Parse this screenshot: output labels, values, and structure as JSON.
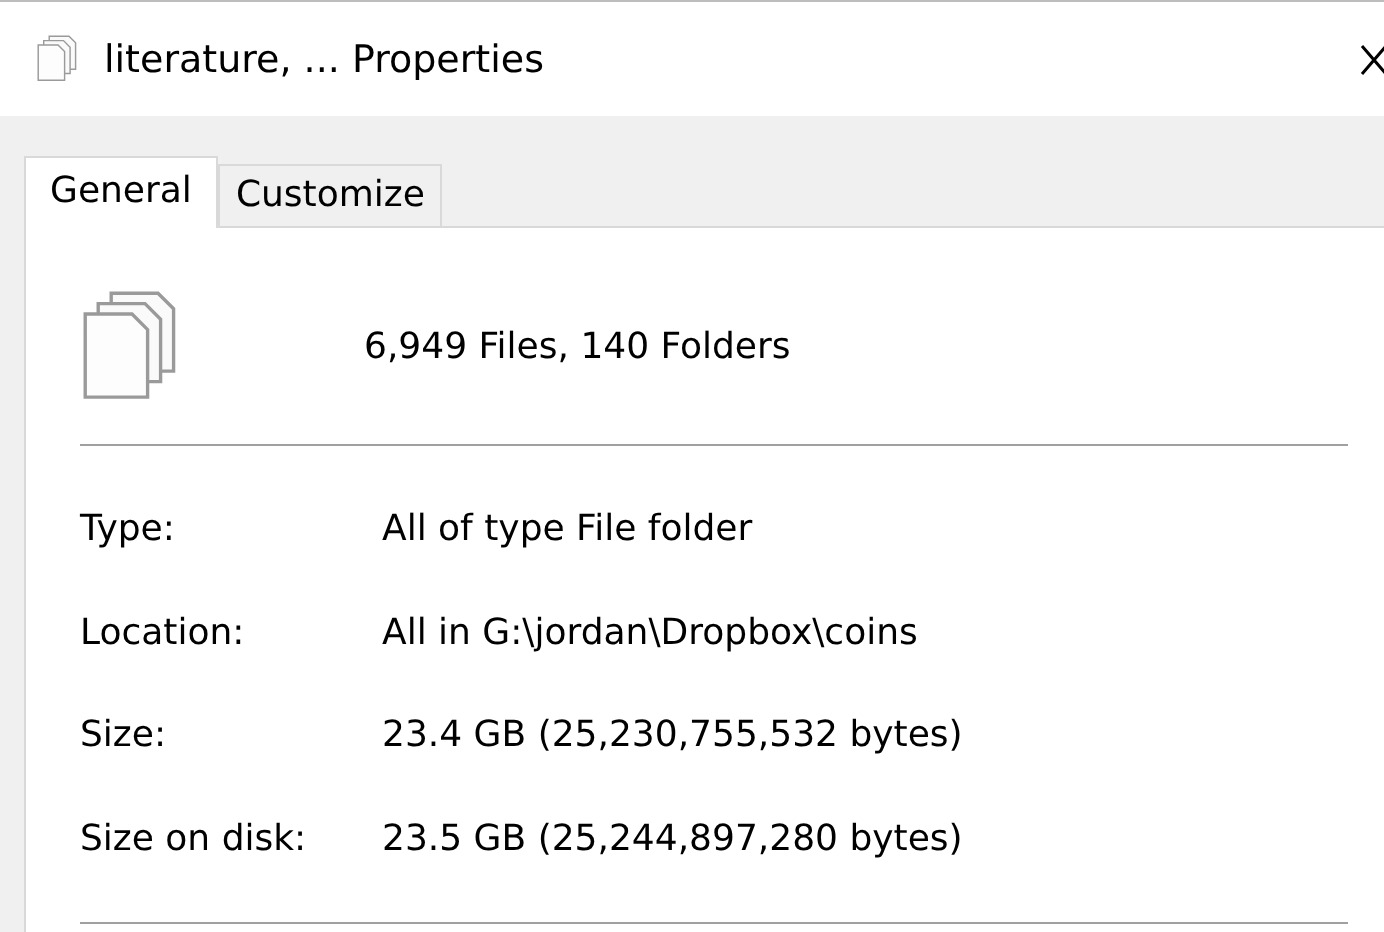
{
  "window": {
    "title": "literature, ... Properties"
  },
  "tabs": [
    {
      "label": "General",
      "selected": true
    },
    {
      "label": "Customize",
      "selected": false
    }
  ],
  "summary": "6,949 Files, 140 Folders",
  "properties": [
    {
      "label": "Type:",
      "value": "All of type File folder"
    },
    {
      "label": "Location:",
      "value": "All in G:\\jordan\\Dropbox\\coins"
    },
    {
      "label": "Size:",
      "value": "23.4 GB (25,230,755,532 bytes)"
    },
    {
      "label": "Size on disk:",
      "value": "23.5 GB (25,244,897,280 bytes)"
    }
  ]
}
